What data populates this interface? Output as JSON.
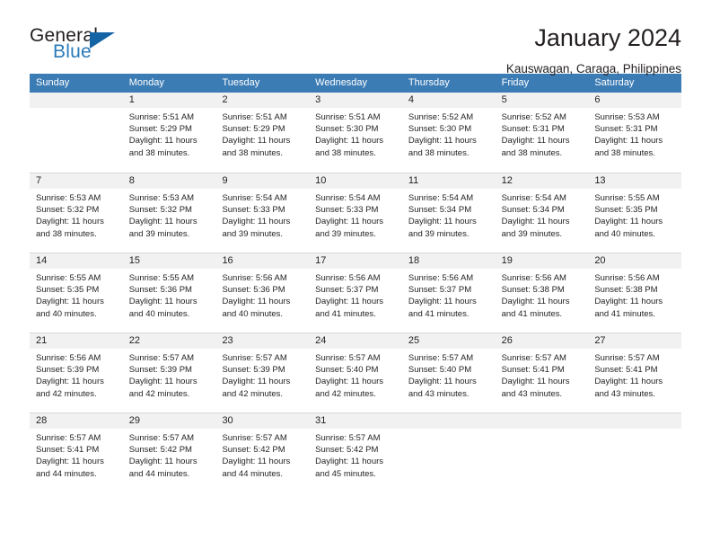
{
  "logo": {
    "word_top": "General",
    "word_bottom": "Blue",
    "triangle_color": "#1363a5",
    "blue_color": "#2a7ab9"
  },
  "header": {
    "title": "January 2024",
    "subtitle": "Kauswagan, Caraga, Philippines"
  },
  "calendar": {
    "header_bg": "#3c7cb5",
    "daynum_bg": "#f1f1f1",
    "weekdays": [
      "Sunday",
      "Monday",
      "Tuesday",
      "Wednesday",
      "Thursday",
      "Friday",
      "Saturday"
    ],
    "weeks": [
      [
        {
          "day": "",
          "lines": []
        },
        {
          "day": "1",
          "lines": [
            "Sunrise: 5:51 AM",
            "Sunset: 5:29 PM",
            "Daylight: 11 hours",
            "and 38 minutes."
          ]
        },
        {
          "day": "2",
          "lines": [
            "Sunrise: 5:51 AM",
            "Sunset: 5:29 PM",
            "Daylight: 11 hours",
            "and 38 minutes."
          ]
        },
        {
          "day": "3",
          "lines": [
            "Sunrise: 5:51 AM",
            "Sunset: 5:30 PM",
            "Daylight: 11 hours",
            "and 38 minutes."
          ]
        },
        {
          "day": "4",
          "lines": [
            "Sunrise: 5:52 AM",
            "Sunset: 5:30 PM",
            "Daylight: 11 hours",
            "and 38 minutes."
          ]
        },
        {
          "day": "5",
          "lines": [
            "Sunrise: 5:52 AM",
            "Sunset: 5:31 PM",
            "Daylight: 11 hours",
            "and 38 minutes."
          ]
        },
        {
          "day": "6",
          "lines": [
            "Sunrise: 5:53 AM",
            "Sunset: 5:31 PM",
            "Daylight: 11 hours",
            "and 38 minutes."
          ]
        }
      ],
      [
        {
          "day": "7",
          "lines": [
            "Sunrise: 5:53 AM",
            "Sunset: 5:32 PM",
            "Daylight: 11 hours",
            "and 38 minutes."
          ]
        },
        {
          "day": "8",
          "lines": [
            "Sunrise: 5:53 AM",
            "Sunset: 5:32 PM",
            "Daylight: 11 hours",
            "and 39 minutes."
          ]
        },
        {
          "day": "9",
          "lines": [
            "Sunrise: 5:54 AM",
            "Sunset: 5:33 PM",
            "Daylight: 11 hours",
            "and 39 minutes."
          ]
        },
        {
          "day": "10",
          "lines": [
            "Sunrise: 5:54 AM",
            "Sunset: 5:33 PM",
            "Daylight: 11 hours",
            "and 39 minutes."
          ]
        },
        {
          "day": "11",
          "lines": [
            "Sunrise: 5:54 AM",
            "Sunset: 5:34 PM",
            "Daylight: 11 hours",
            "and 39 minutes."
          ]
        },
        {
          "day": "12",
          "lines": [
            "Sunrise: 5:54 AM",
            "Sunset: 5:34 PM",
            "Daylight: 11 hours",
            "and 39 minutes."
          ]
        },
        {
          "day": "13",
          "lines": [
            "Sunrise: 5:55 AM",
            "Sunset: 5:35 PM",
            "Daylight: 11 hours",
            "and 40 minutes."
          ]
        }
      ],
      [
        {
          "day": "14",
          "lines": [
            "Sunrise: 5:55 AM",
            "Sunset: 5:35 PM",
            "Daylight: 11 hours",
            "and 40 minutes."
          ]
        },
        {
          "day": "15",
          "lines": [
            "Sunrise: 5:55 AM",
            "Sunset: 5:36 PM",
            "Daylight: 11 hours",
            "and 40 minutes."
          ]
        },
        {
          "day": "16",
          "lines": [
            "Sunrise: 5:56 AM",
            "Sunset: 5:36 PM",
            "Daylight: 11 hours",
            "and 40 minutes."
          ]
        },
        {
          "day": "17",
          "lines": [
            "Sunrise: 5:56 AM",
            "Sunset: 5:37 PM",
            "Daylight: 11 hours",
            "and 41 minutes."
          ]
        },
        {
          "day": "18",
          "lines": [
            "Sunrise: 5:56 AM",
            "Sunset: 5:37 PM",
            "Daylight: 11 hours",
            "and 41 minutes."
          ]
        },
        {
          "day": "19",
          "lines": [
            "Sunrise: 5:56 AM",
            "Sunset: 5:38 PM",
            "Daylight: 11 hours",
            "and 41 minutes."
          ]
        },
        {
          "day": "20",
          "lines": [
            "Sunrise: 5:56 AM",
            "Sunset: 5:38 PM",
            "Daylight: 11 hours",
            "and 41 minutes."
          ]
        }
      ],
      [
        {
          "day": "21",
          "lines": [
            "Sunrise: 5:56 AM",
            "Sunset: 5:39 PM",
            "Daylight: 11 hours",
            "and 42 minutes."
          ]
        },
        {
          "day": "22",
          "lines": [
            "Sunrise: 5:57 AM",
            "Sunset: 5:39 PM",
            "Daylight: 11 hours",
            "and 42 minutes."
          ]
        },
        {
          "day": "23",
          "lines": [
            "Sunrise: 5:57 AM",
            "Sunset: 5:39 PM",
            "Daylight: 11 hours",
            "and 42 minutes."
          ]
        },
        {
          "day": "24",
          "lines": [
            "Sunrise: 5:57 AM",
            "Sunset: 5:40 PM",
            "Daylight: 11 hours",
            "and 42 minutes."
          ]
        },
        {
          "day": "25",
          "lines": [
            "Sunrise: 5:57 AM",
            "Sunset: 5:40 PM",
            "Daylight: 11 hours",
            "and 43 minutes."
          ]
        },
        {
          "day": "26",
          "lines": [
            "Sunrise: 5:57 AM",
            "Sunset: 5:41 PM",
            "Daylight: 11 hours",
            "and 43 minutes."
          ]
        },
        {
          "day": "27",
          "lines": [
            "Sunrise: 5:57 AM",
            "Sunset: 5:41 PM",
            "Daylight: 11 hours",
            "and 43 minutes."
          ]
        }
      ],
      [
        {
          "day": "28",
          "lines": [
            "Sunrise: 5:57 AM",
            "Sunset: 5:41 PM",
            "Daylight: 11 hours",
            "and 44 minutes."
          ]
        },
        {
          "day": "29",
          "lines": [
            "Sunrise: 5:57 AM",
            "Sunset: 5:42 PM",
            "Daylight: 11 hours",
            "and 44 minutes."
          ]
        },
        {
          "day": "30",
          "lines": [
            "Sunrise: 5:57 AM",
            "Sunset: 5:42 PM",
            "Daylight: 11 hours",
            "and 44 minutes."
          ]
        },
        {
          "day": "31",
          "lines": [
            "Sunrise: 5:57 AM",
            "Sunset: 5:42 PM",
            "Daylight: 11 hours",
            "and 45 minutes."
          ]
        },
        {
          "day": "",
          "lines": []
        },
        {
          "day": "",
          "lines": []
        },
        {
          "day": "",
          "lines": []
        }
      ]
    ]
  }
}
